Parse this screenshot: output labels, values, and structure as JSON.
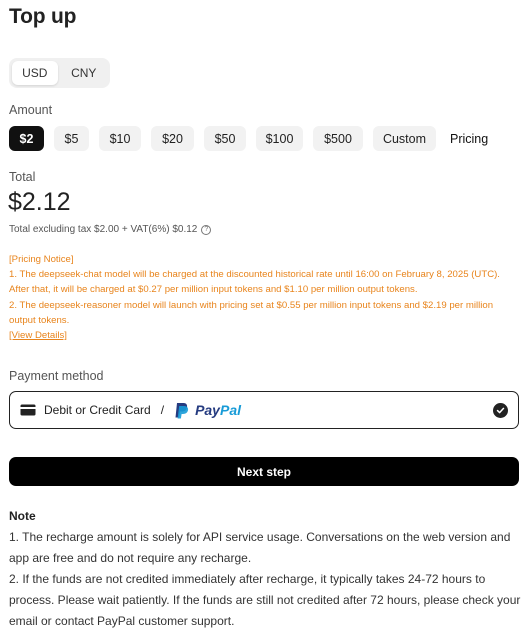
{
  "header": {
    "title": "Top up"
  },
  "currency": {
    "options": [
      "USD",
      "CNY"
    ],
    "selected": "USD"
  },
  "amount": {
    "label": "Amount",
    "options": [
      "$2",
      "$5",
      "$10",
      "$20",
      "$50",
      "$100",
      "$500",
      "Custom"
    ],
    "selected": "$2",
    "pricing_link": "Pricing"
  },
  "total": {
    "label": "Total",
    "value": "$2.12",
    "tax_line": "Total excluding tax $2.00 + VAT(6%) $0.12"
  },
  "notice": {
    "heading": "[Pricing Notice]",
    "line1": "1. The deepseek-chat model will be charged at the discounted historical rate until 16:00 on February 8, 2025 (UTC). After that, it will be charged at $0.27 per million input tokens and $1.10 per million output tokens.",
    "line2": "2. The deepseek-reasoner model will launch with pricing set at $0.55 per million input tokens and $2.19 per million output tokens.",
    "link": "[View Details]"
  },
  "payment": {
    "label": "Payment method",
    "option_text": "Debit or Credit Card",
    "separator": "/",
    "paypal_pay": "Pay",
    "paypal_pal": "Pal"
  },
  "actions": {
    "next": "Next step"
  },
  "note": {
    "title": "Note",
    "line1": "1. The recharge amount is solely for API service usage. Conversations on the web version and app are free and do not require any recharge.",
    "line2": "2. If the funds are not credited immediately after recharge, it typically takes 24-72 hours to process. Please wait patiently. If the funds are still not credited after 72 hours, please check your email or contact PayPal customer support."
  },
  "colors": {
    "accent": "#111111",
    "notice": "#e8841c",
    "paypal_dark": "#253b80",
    "paypal_light": "#179bd7"
  }
}
